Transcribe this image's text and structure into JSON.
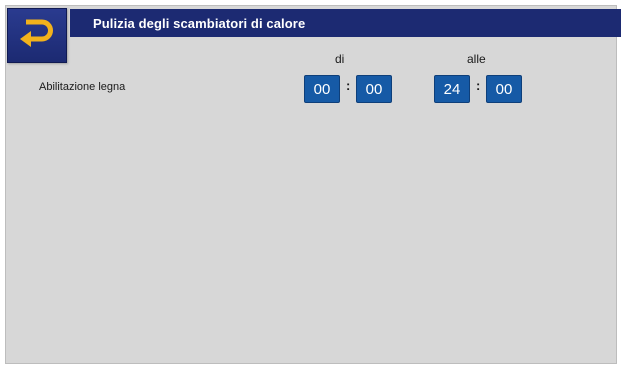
{
  "header": {
    "title": "Pulizia degli scambiatori di calore"
  },
  "columns": {
    "from_label": "di",
    "to_label": "alle"
  },
  "rows": [
    {
      "label": "Abilitazione legna",
      "from_hour": "00",
      "from_minute": "00",
      "to_hour": "24",
      "to_minute": "00"
    }
  ],
  "separator": ":",
  "icons": {
    "back": "return-arrow-icon"
  },
  "colors": {
    "header_bg": "#1c2a72",
    "field_bg": "#165aa6",
    "back_arrow": "#f2b21c",
    "panel_bg": "#d7d7d7"
  }
}
